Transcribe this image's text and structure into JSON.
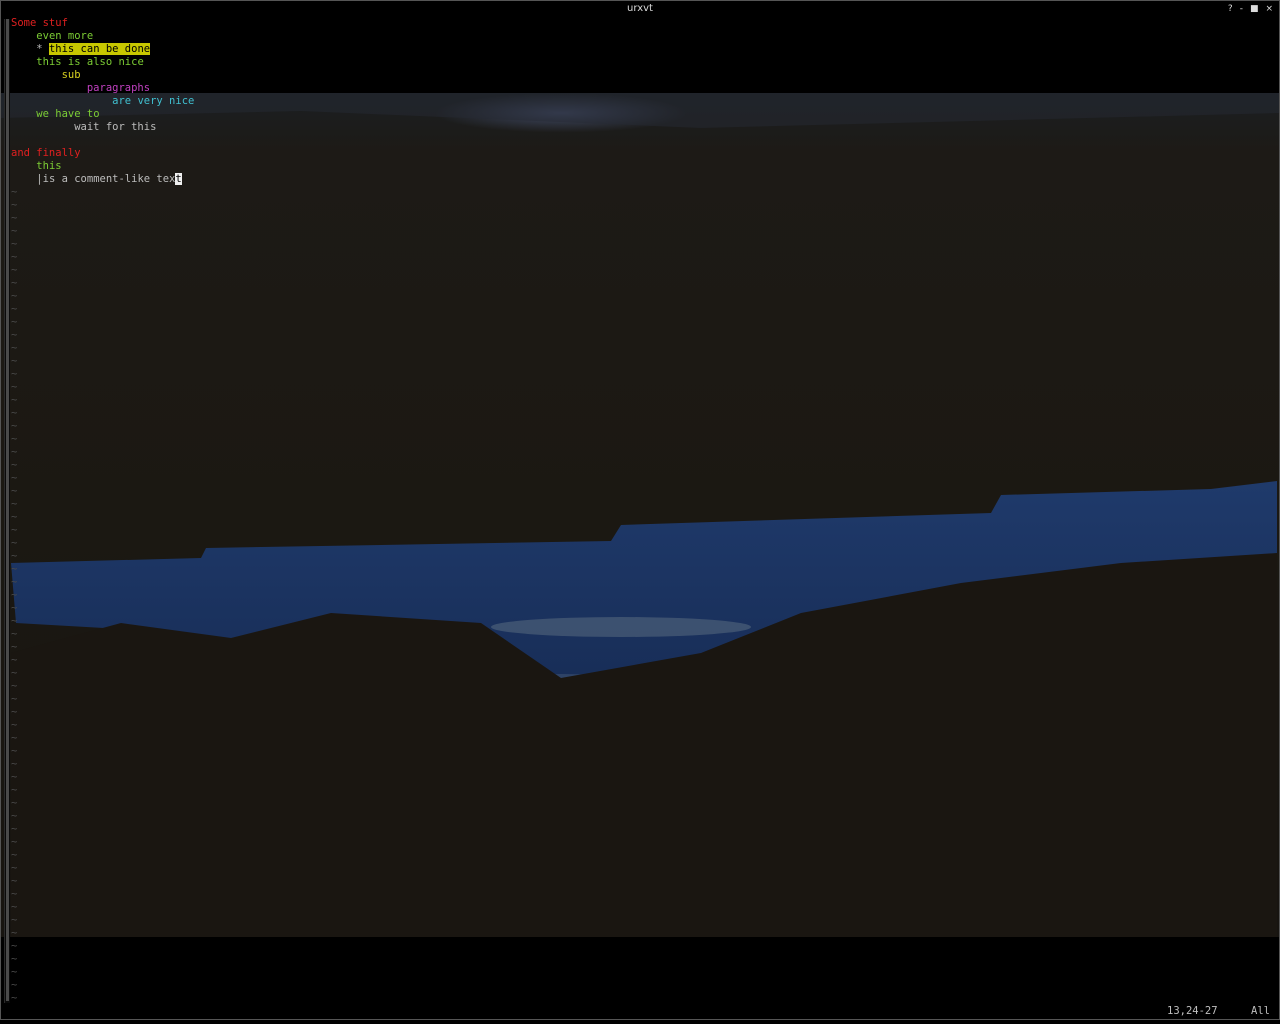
{
  "window": {
    "title": "urxvt",
    "controls": [
      "?",
      "-",
      "■",
      "×"
    ]
  },
  "editor": {
    "lines": [
      {
        "indent": "",
        "text": "Some stuf",
        "color": "#e02020"
      },
      {
        "indent": "    ",
        "text": "even more",
        "color": "#7ccd34"
      },
      {
        "indent": "    ",
        "prefix": "* ",
        "text": "this can be done",
        "color": "#000000",
        "highlight": "#c8c800"
      },
      {
        "indent": "    ",
        "text": "this is also nice",
        "color": "#7ccd34"
      },
      {
        "indent": "        ",
        "text": "sub",
        "color": "#d8d020"
      },
      {
        "indent": "            ",
        "text": "paragraphs",
        "color": "#c040c0"
      },
      {
        "indent": "                ",
        "text": "are very nice",
        "color": "#40c0d0"
      },
      {
        "indent": "    ",
        "text": "we have to",
        "color": "#7ccd34"
      },
      {
        "indent": "          ",
        "text": "wait for this",
        "color": "#bcbcbc"
      },
      {
        "indent": "",
        "text": "",
        "color": "#bcbcbc"
      },
      {
        "indent": "",
        "text": "and finally",
        "color": "#e02020"
      },
      {
        "indent": "    ",
        "text": "this",
        "color": "#7ccd34"
      },
      {
        "indent": "    ",
        "text": "|is a comment-like tex",
        "cursor": "t",
        "color": "#bcbcbc"
      }
    ],
    "tilde_char": "~",
    "tilde_count": 63
  },
  "statusline": {
    "position": "13,24-27",
    "scroll": "All"
  },
  "colors": {
    "background": "#000000",
    "tilde": "#4a4a4a",
    "lake": "#1e3563",
    "forest": "#1c1914"
  }
}
